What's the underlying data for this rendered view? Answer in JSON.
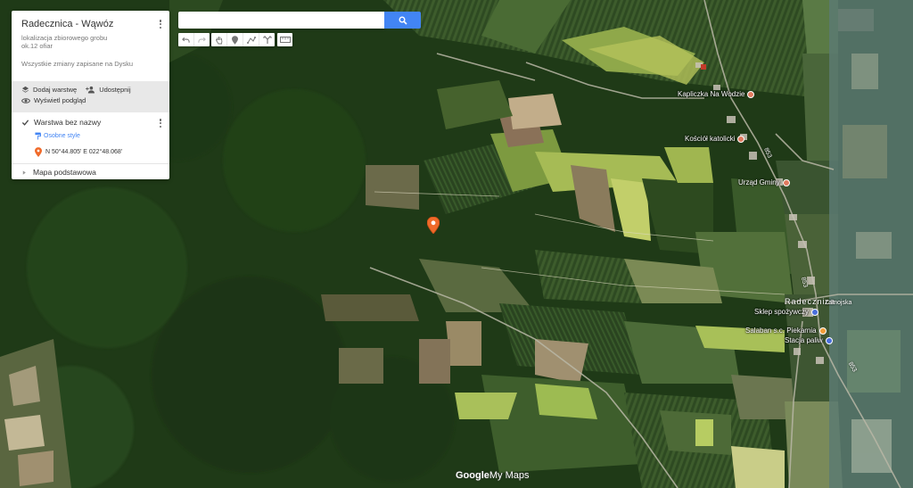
{
  "panel": {
    "title": "Radecznica - Wąwóz",
    "description_line1": "lokalizacja zbiorowego grobu",
    "description_line2": "ok.12 ofiar",
    "save_status": "Wszystkie zmiany zapisane na Dysku",
    "add_layer_label": "Dodaj warstwę",
    "share_label": "Udostępnij",
    "preview_label": "Wyświetl podgląd",
    "layer_name": "Warstwa bez nazwy",
    "layer_style_label": "Osobne style",
    "feature_label": "N 50°44.805' E 022°48.068'",
    "basemap_label": "Mapa podstawowa"
  },
  "search": {
    "value": "",
    "placeholder": ""
  },
  "toolbar": {
    "icons": [
      "undo-icon",
      "redo-icon",
      "hand-icon",
      "marker-icon",
      "draw-line-icon",
      "directions-icon",
      "ruler-icon"
    ]
  },
  "map_labels": {
    "poi": [
      {
        "name": "Kapliczka Na Wodzie",
        "icon_color": "#e07a5f"
      },
      {
        "name": "Kościół katolicki",
        "icon_color": "#e07a5f"
      },
      {
        "name": "Urząd Gminy",
        "icon_color": "#e07a5f"
      },
      {
        "name": "Sklep spożywczy",
        "icon_color": "#4a6fdc"
      },
      {
        "name": "Salaban s.c. Piekarnia",
        "icon_color": "#f29d38"
      },
      {
        "name": "Stacja paliw",
        "icon_color": "#4a6fdc"
      },
      {
        "name": "Radecznica",
        "icon_color": ""
      },
      {
        "name": "Zamojska",
        "icon_color": ""
      }
    ],
    "road_numbers": [
      "853",
      "853",
      "853"
    ]
  },
  "watermark": {
    "brand": "Google",
    "product": "My Maps"
  },
  "colors": {
    "accent": "#4285f4",
    "marker": "#f06a2a"
  }
}
